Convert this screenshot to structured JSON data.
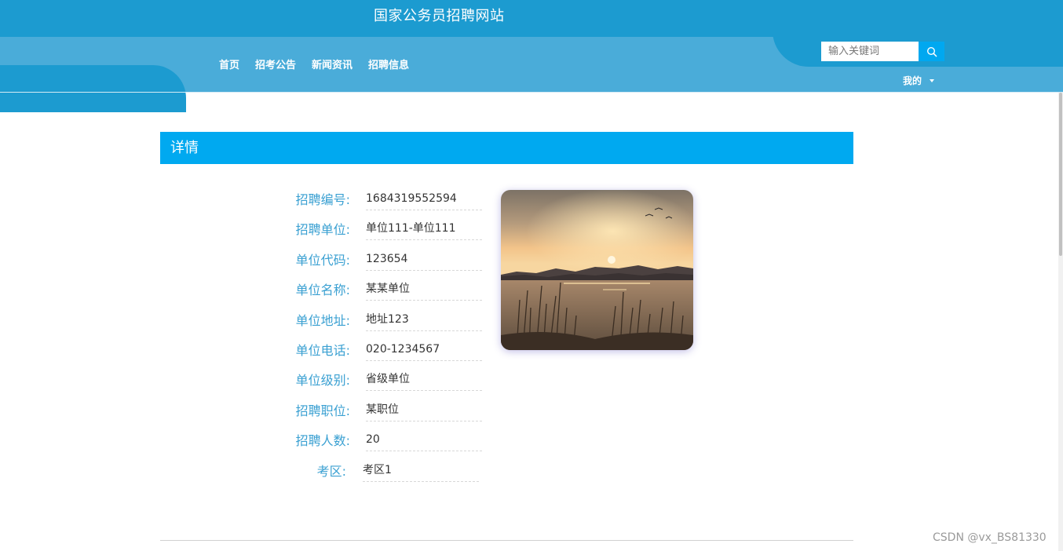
{
  "header": {
    "site_title": "国家公务员招聘网站",
    "nav": [
      {
        "label": "首页"
      },
      {
        "label": "招考公告"
      },
      {
        "label": "新闻资讯"
      },
      {
        "label": "招聘信息"
      }
    ],
    "search": {
      "placeholder": "输入关键词",
      "icon": "search-icon"
    },
    "user_menu": {
      "label": "我的",
      "icon": "caret-down-icon"
    }
  },
  "detail": {
    "title": "详情",
    "fields": [
      {
        "label": "招聘编号:",
        "value": "1684319552594"
      },
      {
        "label": "招聘单位:",
        "value": "单位111-单位111"
      },
      {
        "label": "单位代码:",
        "value": "123654"
      },
      {
        "label": "单位名称:",
        "value": "某某单位"
      },
      {
        "label": "单位地址:",
        "value": "地址123"
      },
      {
        "label": "单位电话:",
        "value": "020-1234567"
      },
      {
        "label": "单位级别:",
        "value": "省级单位"
      },
      {
        "label": "招聘职位:",
        "value": "某职位"
      },
      {
        "label": "招聘人数:",
        "value": "20"
      },
      {
        "label": "考区:",
        "value": "考区1"
      }
    ]
  },
  "watermark": "CSDN @vx_BS81330",
  "colors": {
    "header_dark": "#1c9bd0",
    "header_light": "#4aacd9",
    "accent": "#00a9f0",
    "label": "#3aa0d2"
  }
}
